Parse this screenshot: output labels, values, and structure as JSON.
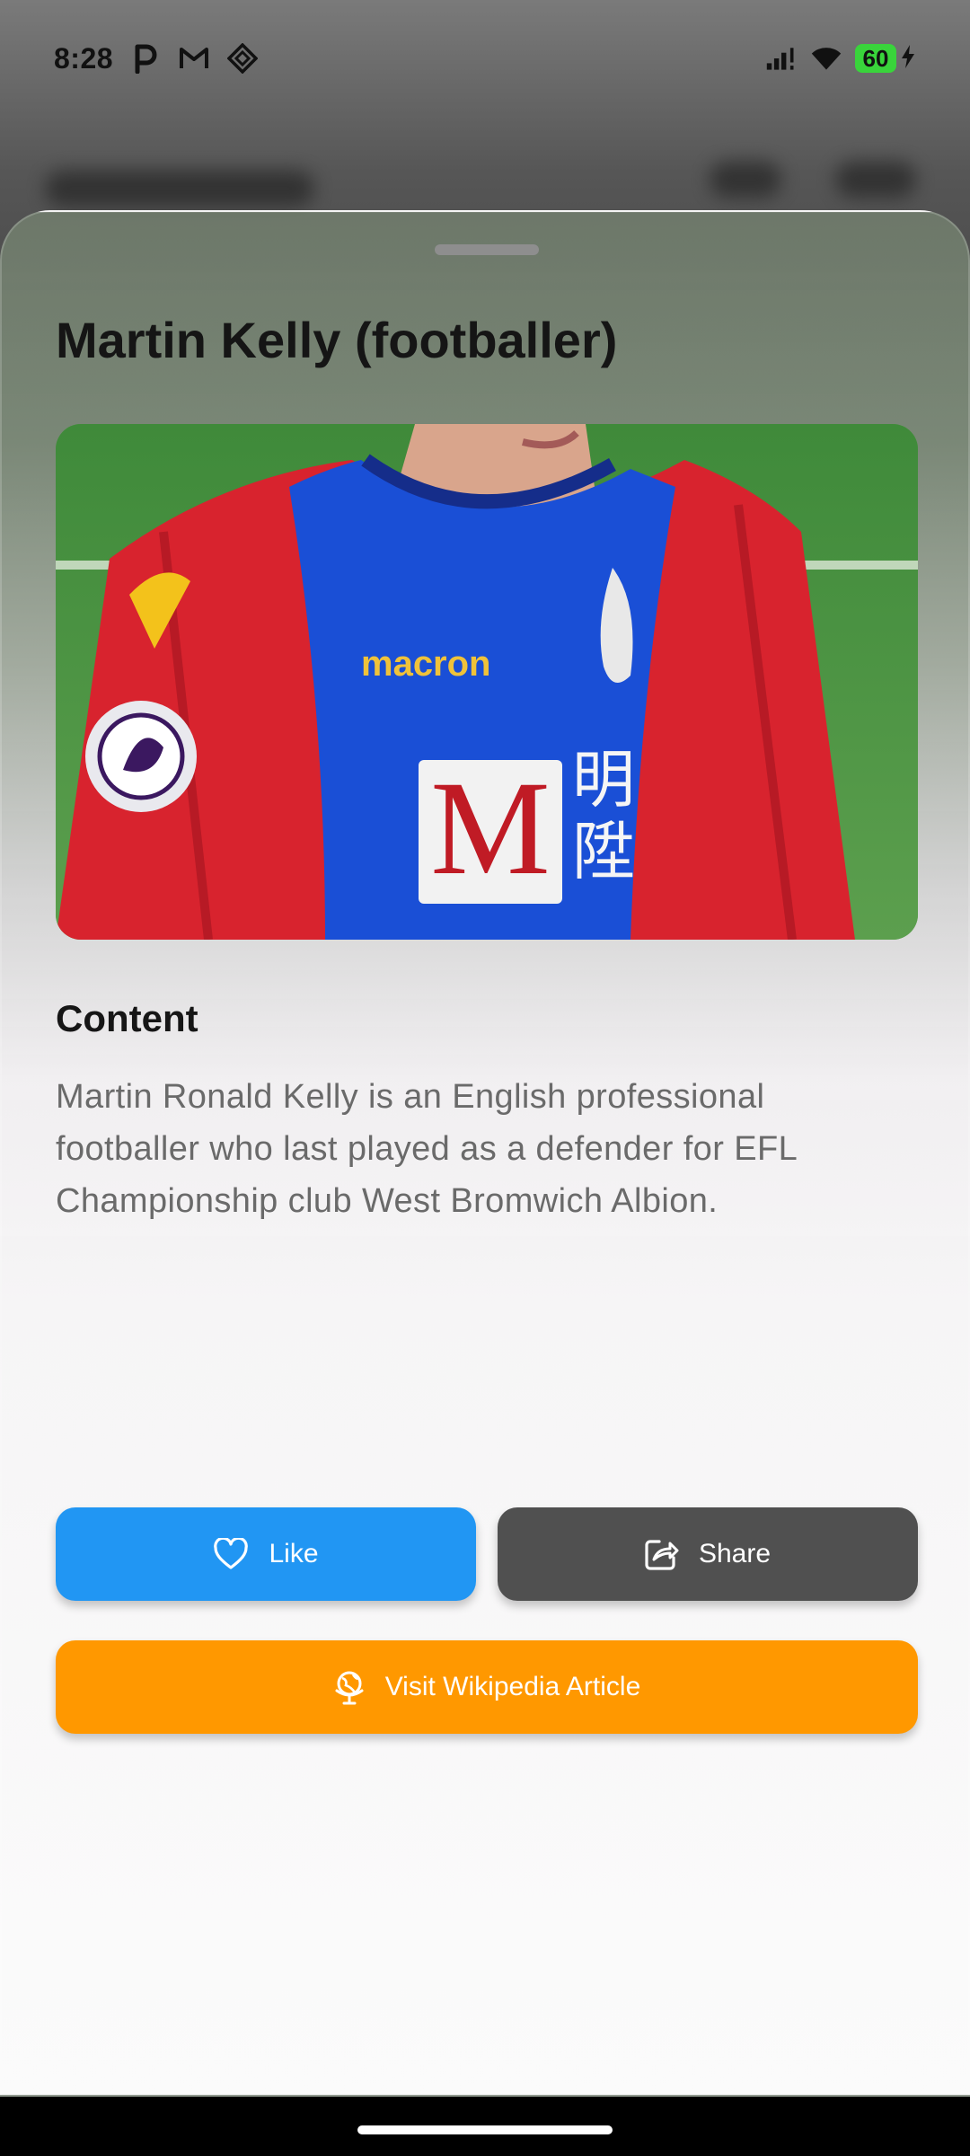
{
  "status_bar": {
    "time": "8:28",
    "notification_icons": [
      "parking-icon",
      "gmail-icon",
      "app-diamond-icon"
    ],
    "battery_level": "60",
    "charging": true,
    "colors": {
      "battery": "#39d43b"
    }
  },
  "sheet": {
    "title": "Martin Kelly (footballer)",
    "image_alt": "Photo of footballer in a red and blue striped kit",
    "content_heading": "Content",
    "content_text": "Martin Ronald Kelly is an English professional footballer who last played as a defender for EFL Championship club West Bromwich Albion."
  },
  "actions": {
    "like_label": "Like",
    "share_label": "Share",
    "visit_label": "Visit Wikipedia Article",
    "colors": {
      "like": "#2196f3",
      "share": "#505050",
      "visit": "#ff9800"
    }
  }
}
